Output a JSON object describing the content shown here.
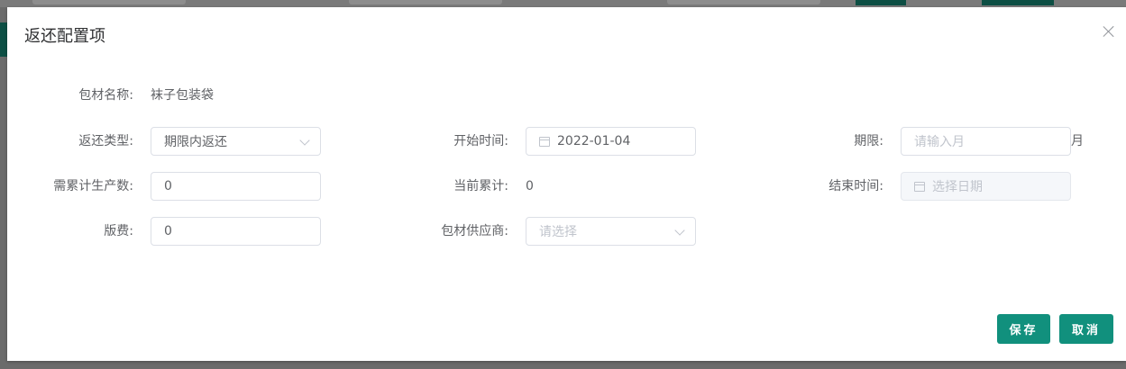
{
  "dialog": {
    "title": "返还配置项",
    "close_icon": "close-icon"
  },
  "form": {
    "material_name": {
      "label": "包材名称:",
      "value": "袜子包装袋"
    },
    "return_type": {
      "label": "返还类型:",
      "value": "期限内返还"
    },
    "start_time": {
      "label": "开始时间:",
      "value": "2022-01-04",
      "icon": "calendar-icon"
    },
    "term": {
      "label": "期限:",
      "placeholder": "请输入月",
      "unit": "月"
    },
    "required_production": {
      "label": "需累计生产数:",
      "value": "0"
    },
    "current_total": {
      "label": "当前累计:",
      "value": "0"
    },
    "end_time": {
      "label": "结束时间:",
      "placeholder": "选择日期",
      "icon": "calendar-icon"
    },
    "version_fee": {
      "label": "版费:",
      "value": "0"
    },
    "supplier": {
      "label": "包材供应商:",
      "placeholder": "请选择"
    }
  },
  "footer": {
    "save_label": "保存",
    "cancel_label": "取消"
  },
  "colors": {
    "primary": "#11907d",
    "overlay": "#6b6b6b"
  }
}
